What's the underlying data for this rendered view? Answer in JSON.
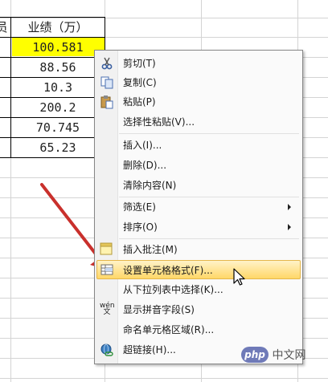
{
  "sheet": {
    "header_left": "员",
    "header_right": "业绩（万）",
    "values": [
      "100.581",
      "88.56",
      "10.3",
      "200.2",
      "70.745",
      "65.23"
    ],
    "selected_fill": "#ffff00"
  },
  "menu": {
    "items": [
      {
        "label": "剪切(T)",
        "icon": "scissors-icon"
      },
      {
        "label": "复制(C)",
        "icon": "copy-icon"
      },
      {
        "label": "粘贴(P)",
        "icon": "paste-icon"
      },
      {
        "label": "选择性粘贴(V)...",
        "icon": ""
      },
      {
        "label": "插入(I)...",
        "icon": ""
      },
      {
        "label": "删除(D)...",
        "icon": ""
      },
      {
        "label": "清除内容(N)",
        "icon": ""
      },
      {
        "label": "筛选(E)",
        "icon": "",
        "submenu": true
      },
      {
        "label": "排序(O)",
        "icon": "",
        "submenu": true
      },
      {
        "label": "插入批注(M)",
        "icon": "comment-icon"
      },
      {
        "label": "设置单元格格式(F)...",
        "icon": "format-cells-icon",
        "highlighted": true
      },
      {
        "label": "从下拉列表中选择(K)...",
        "icon": ""
      },
      {
        "label": "显示拼音字段(S)",
        "icon": "phonetic-icon",
        "icon_text": "wén 文"
      },
      {
        "label": "命名单元格区域(R)...",
        "icon": ""
      },
      {
        "label": "超链接(H)...",
        "icon": "hyperlink-icon"
      }
    ],
    "highlight_color": "#ffd768"
  },
  "watermark": {
    "icon_text": "php",
    "text": "中文网"
  }
}
